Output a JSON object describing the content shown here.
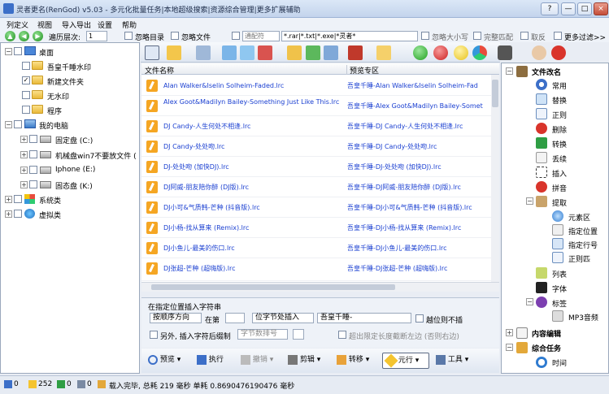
{
  "window": {
    "title": "灵者更名(RenGod) v5.03 - 多元化批量任务|本地超级搜索|资源综合管理|更多扩展辅助"
  },
  "menu": [
    "列定义",
    "视图",
    "导入导出",
    "设置",
    "帮助"
  ],
  "nav": {
    "depth_label": "遍历层次:",
    "depth_value": "1",
    "ignore_dir": "忽略目录",
    "ignore_file": "忽略文件",
    "wildcard_select": "通配符",
    "wildcard_value": "*.rar|*.txt|*.exe|*灵者*",
    "ignore_case": "忽略大小写",
    "full_match": "完整匹配",
    "invert": "取反",
    "more_filters": "更多过滤>>"
  },
  "tree": [
    {
      "label": "桌面",
      "type": "desktop"
    },
    {
      "label": "吾皇千睡水印",
      "type": "folder"
    },
    {
      "label": "新建文件夹",
      "type": "folder",
      "checked": true
    },
    {
      "label": "无水印",
      "type": "folder"
    },
    {
      "label": "程序",
      "type": "folder"
    },
    {
      "label": "我的电脑",
      "type": "computer"
    },
    {
      "label": "固定盘 (C:)",
      "type": "drive"
    },
    {
      "label": "机械盘win7不要放文件 (",
      "type": "drive"
    },
    {
      "label": "Iphone (E:)",
      "type": "drive"
    },
    {
      "label": "固态盘 (K:)",
      "type": "drive"
    },
    {
      "label": "系统类",
      "type": "category"
    },
    {
      "label": "虚拟类",
      "type": "category"
    }
  ],
  "file_list": {
    "col_name": "文件名称",
    "col_preview": "预览专区",
    "rows": [
      {
        "name": "Alan Walker&Iselin Solheim-Faded.lrc",
        "preview": "吾皇千睡-Alan Walker&Iselin Solheim-Fad"
      },
      {
        "name": "Alex Goot&Madilyn Bailey-Something Just Like This.lrc",
        "preview": "吾皇千睡-Alex Goot&Madilyn Bailey-Somet"
      },
      {
        "name": "DJ Candy-人生何处不相逢.lrc",
        "preview": "吾皇千睡-DJ Candy-人生何处不相逢.lrc"
      },
      {
        "name": "DJ Candy-处处吻.lrc",
        "preview": "吾皇千睡-DJ Candy-处处吻.lrc"
      },
      {
        "name": "DJ-处处吻 (加快DJ).lrc",
        "preview": "吾皇千睡-DJ-处处吻 (加快DJ).lrc"
      },
      {
        "name": "DJ阿威-朋友陪你醉 (DJ版).lrc",
        "preview": "吾皇千睡-DJ阿威-朋友陪你醉 (DJ版).lrc"
      },
      {
        "name": "DJ小可&气质韩-芒种 (抖音版).lrc",
        "preview": "吾皇千睡-DJ小可&气质韩-芒种 (抖音版).lrc"
      },
      {
        "name": "DJ小杨-找从算来 (Remix).lrc",
        "preview": "吾皇千睡-DJ小杨-找从算来 (Remix).lrc"
      },
      {
        "name": "DJ小鱼儿-最美的伤口.lrc",
        "preview": "吾皇千睡-DJ小鱼儿-最美的伤口.lrc"
      },
      {
        "name": "DJ张超-芒种 (超嗨版).lrc",
        "preview": "吾皇千睡-DJ张超-芒种 (超嗨版).lrc"
      }
    ]
  },
  "insert_panel": {
    "title": "在指定位置插入字符串",
    "order_select": "按顺序方向",
    "at_label": "在第",
    "pos_select": "位字节处插入",
    "text_value": "吾皇千睡-",
    "skip_label": "越位则不插",
    "also_label": "另外, 插入字符后缀制",
    "format_select": "字节数排号",
    "exceed_label": "超出限定长度截断左边 (否则右边)"
  },
  "bottom_buttons": [
    "预览",
    "执行",
    "撤销",
    "剪辑",
    "转移",
    "元行",
    "工具"
  ],
  "right_panel": [
    {
      "label": "文件改名",
      "bold": true
    },
    {
      "label": "常用"
    },
    {
      "label": "替换"
    },
    {
      "label": "正则"
    },
    {
      "label": "删除"
    },
    {
      "label": "转换"
    },
    {
      "label": "丢续"
    },
    {
      "label": "插入"
    },
    {
      "label": "拼音"
    },
    {
      "label": "提取"
    },
    {
      "label": "元素区"
    },
    {
      "label": "指定位置"
    },
    {
      "label": "指定行号"
    },
    {
      "label": "正则匹"
    },
    {
      "label": "列表"
    },
    {
      "label": "字体"
    },
    {
      "label": "标签"
    },
    {
      "label": "MP3音频"
    },
    {
      "label": "内容编辑",
      "bold": true
    },
    {
      "label": "综合任务",
      "bold": true
    },
    {
      "label": "时间"
    }
  ],
  "status": {
    "count1": "0",
    "count2": "252",
    "count3": "0",
    "count4": "0",
    "message": "载入完毕, 总耗 219 毫秒 单耗 0.8690476190476 毫秒"
  },
  "colors": {
    "link": "#1a3fd1",
    "accent": "#3c6fc8"
  }
}
